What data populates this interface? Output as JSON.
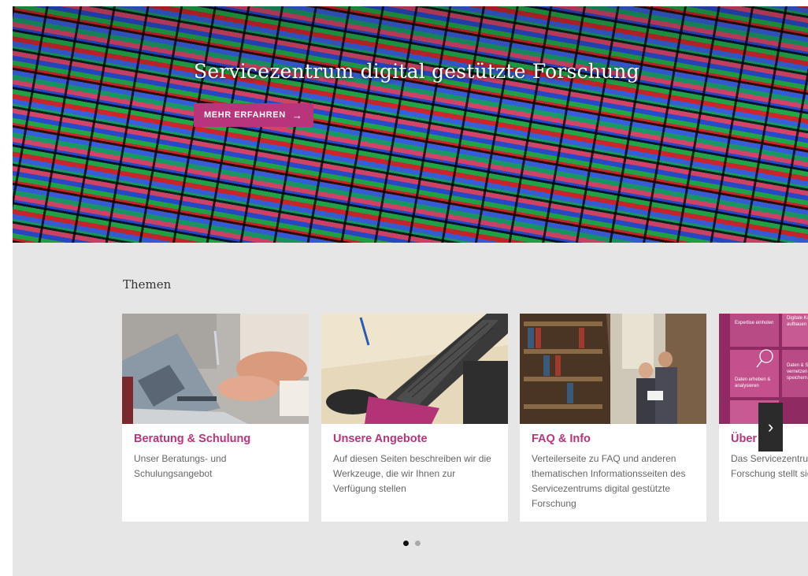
{
  "hero": {
    "title": "Servicezentrum digital gestützte Forschung",
    "button_label": "MEHR ERFAHREN",
    "button_icon": "arrow-right-icon"
  },
  "section": {
    "title": "Themen"
  },
  "cards": [
    {
      "title": "Beratung & Schulung",
      "text": "Unser Beratungs- und Schulungsangebot",
      "image": "laptop-meeting-photo"
    },
    {
      "title": "Unsere Angebote",
      "text": "Auf diesen Seiten beschreiben wir die Werkzeuge, die wir Ihnen zur Verfügung stellen",
      "image": "keyboard-mouse-photo"
    },
    {
      "title": "FAQ & Info",
      "text": "Verteilerseite zu FAQ und anderen thematischen Informationsseiten des Servicezentrums digital gestützte Forschung",
      "image": "library-photo"
    },
    {
      "title": "Über uns",
      "text": "Das Servicezentrum digital gestützte Forschung stellt sich vor",
      "image": "service-tiles-graphic",
      "tiles": [
        "Expertise einholen",
        "Digitale Kompetenz aufbauen",
        "Daten erheben & analysieren",
        "Daten & Software vernetzen & speichern"
      ]
    }
  ],
  "carousel": {
    "next_icon": "chevron-right-icon",
    "pages": 2,
    "active_page": 1
  },
  "colors": {
    "accent": "#b8347b",
    "section_bg": "#e6e6e6",
    "text_muted": "#666666"
  }
}
